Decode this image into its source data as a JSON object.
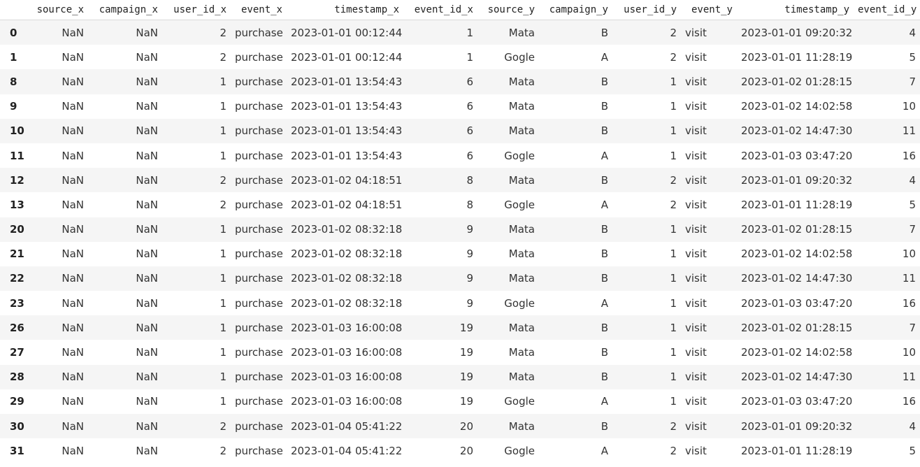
{
  "table": {
    "headers": [
      "",
      "source_x",
      "campaign_x",
      "user_id_x",
      "event_x",
      "timestamp_x",
      "event_id_x",
      "source_y",
      "campaign_y",
      "user_id_y",
      "event_y",
      "timestamp_y",
      "event_id_y"
    ],
    "rows": [
      [
        "0",
        "NaN",
        "NaN",
        "2",
        "purchase",
        "2023-01-01 00:12:44",
        "1",
        "Mata",
        "B",
        "2",
        "visit",
        "2023-01-01 09:20:32",
        "4"
      ],
      [
        "1",
        "NaN",
        "NaN",
        "2",
        "purchase",
        "2023-01-01 00:12:44",
        "1",
        "Gogle",
        "A",
        "2",
        "visit",
        "2023-01-01 11:28:19",
        "5"
      ],
      [
        "8",
        "NaN",
        "NaN",
        "1",
        "purchase",
        "2023-01-01 13:54:43",
        "6",
        "Mata",
        "B",
        "1",
        "visit",
        "2023-01-02 01:28:15",
        "7"
      ],
      [
        "9",
        "NaN",
        "NaN",
        "1",
        "purchase",
        "2023-01-01 13:54:43",
        "6",
        "Mata",
        "B",
        "1",
        "visit",
        "2023-01-02 14:02:58",
        "10"
      ],
      [
        "10",
        "NaN",
        "NaN",
        "1",
        "purchase",
        "2023-01-01 13:54:43",
        "6",
        "Mata",
        "B",
        "1",
        "visit",
        "2023-01-02 14:47:30",
        "11"
      ],
      [
        "11",
        "NaN",
        "NaN",
        "1",
        "purchase",
        "2023-01-01 13:54:43",
        "6",
        "Gogle",
        "A",
        "1",
        "visit",
        "2023-01-03 03:47:20",
        "16"
      ],
      [
        "12",
        "NaN",
        "NaN",
        "2",
        "purchase",
        "2023-01-02 04:18:51",
        "8",
        "Mata",
        "B",
        "2",
        "visit",
        "2023-01-01 09:20:32",
        "4"
      ],
      [
        "13",
        "NaN",
        "NaN",
        "2",
        "purchase",
        "2023-01-02 04:18:51",
        "8",
        "Gogle",
        "A",
        "2",
        "visit",
        "2023-01-01 11:28:19",
        "5"
      ],
      [
        "20",
        "NaN",
        "NaN",
        "1",
        "purchase",
        "2023-01-02 08:32:18",
        "9",
        "Mata",
        "B",
        "1",
        "visit",
        "2023-01-02 01:28:15",
        "7"
      ],
      [
        "21",
        "NaN",
        "NaN",
        "1",
        "purchase",
        "2023-01-02 08:32:18",
        "9",
        "Mata",
        "B",
        "1",
        "visit",
        "2023-01-02 14:02:58",
        "10"
      ],
      [
        "22",
        "NaN",
        "NaN",
        "1",
        "purchase",
        "2023-01-02 08:32:18",
        "9",
        "Mata",
        "B",
        "1",
        "visit",
        "2023-01-02 14:47:30",
        "11"
      ],
      [
        "23",
        "NaN",
        "NaN",
        "1",
        "purchase",
        "2023-01-02 08:32:18",
        "9",
        "Gogle",
        "A",
        "1",
        "visit",
        "2023-01-03 03:47:20",
        "16"
      ],
      [
        "26",
        "NaN",
        "NaN",
        "1",
        "purchase",
        "2023-01-03 16:00:08",
        "19",
        "Mata",
        "B",
        "1",
        "visit",
        "2023-01-02 01:28:15",
        "7"
      ],
      [
        "27",
        "NaN",
        "NaN",
        "1",
        "purchase",
        "2023-01-03 16:00:08",
        "19",
        "Mata",
        "B",
        "1",
        "visit",
        "2023-01-02 14:02:58",
        "10"
      ],
      [
        "28",
        "NaN",
        "NaN",
        "1",
        "purchase",
        "2023-01-03 16:00:08",
        "19",
        "Mata",
        "B",
        "1",
        "visit",
        "2023-01-02 14:47:30",
        "11"
      ],
      [
        "29",
        "NaN",
        "NaN",
        "1",
        "purchase",
        "2023-01-03 16:00:08",
        "19",
        "Gogle",
        "A",
        "1",
        "visit",
        "2023-01-03 03:47:20",
        "16"
      ],
      [
        "30",
        "NaN",
        "NaN",
        "2",
        "purchase",
        "2023-01-04 05:41:22",
        "20",
        "Mata",
        "B",
        "2",
        "visit",
        "2023-01-01 09:20:32",
        "4"
      ],
      [
        "31",
        "NaN",
        "NaN",
        "2",
        "purchase",
        "2023-01-04 05:41:22",
        "20",
        "Gogle",
        "A",
        "2",
        "visit",
        "2023-01-01 11:28:19",
        "5"
      ]
    ]
  }
}
